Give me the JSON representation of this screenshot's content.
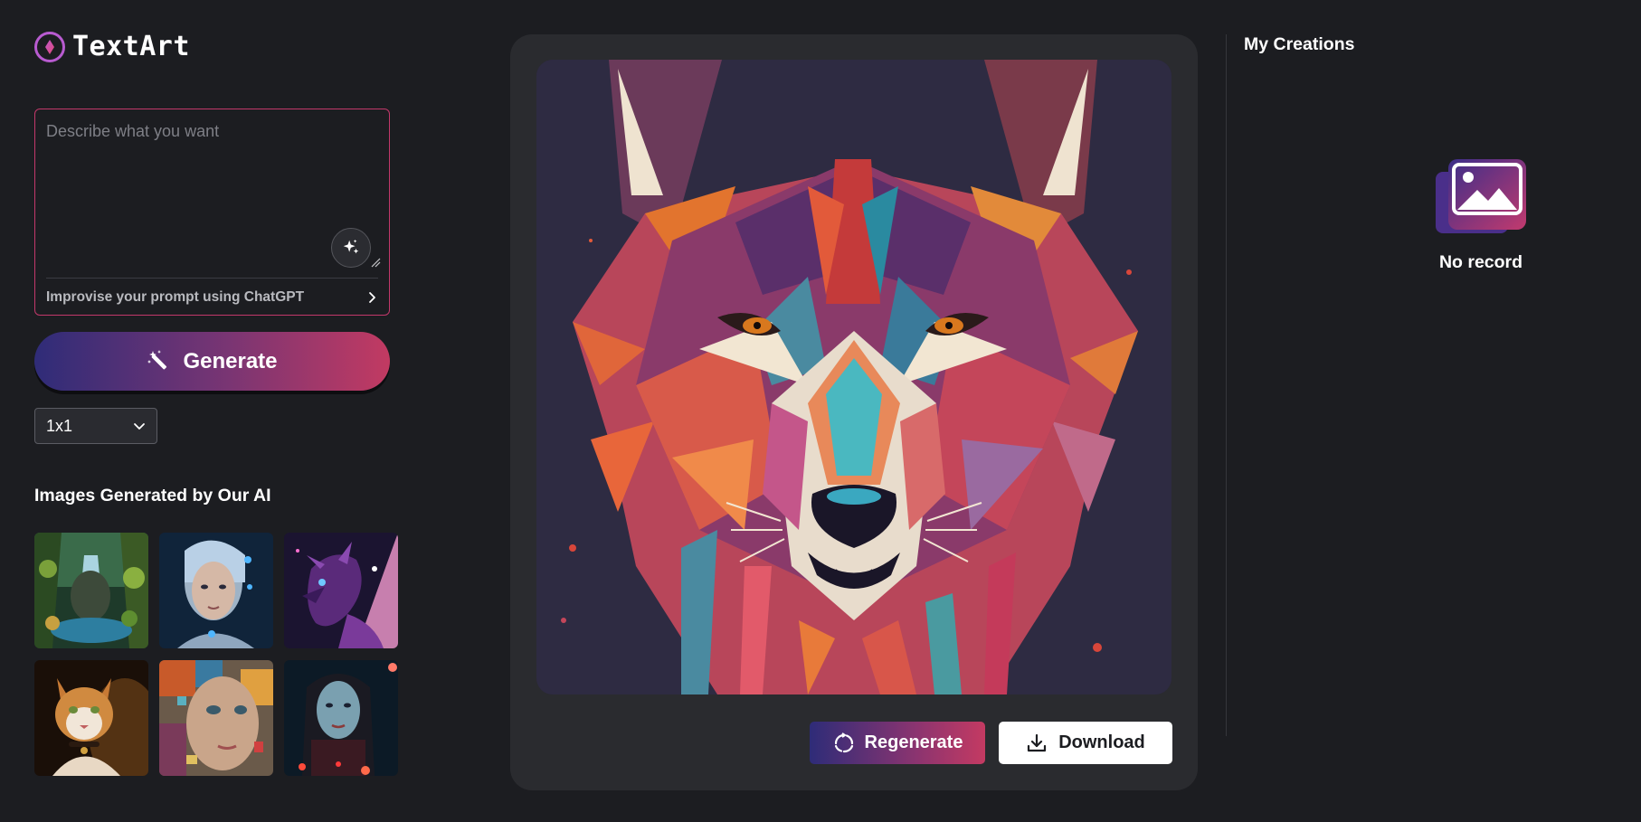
{
  "app": {
    "name": "TextArt"
  },
  "prompt": {
    "placeholder": "Describe what you want",
    "value": "",
    "improve_label": "Improvise your prompt using ChatGPT"
  },
  "generate": {
    "label": "Generate"
  },
  "aspect_ratio": {
    "selected": "1x1"
  },
  "gallery": {
    "title": "Images Generated by Our AI",
    "items": [
      {
        "subject": "fantasy forest waterfall"
      },
      {
        "subject": "cyborg girl portrait"
      },
      {
        "subject": "purple dragon"
      },
      {
        "subject": "cat with collar"
      },
      {
        "subject": "mosaic face"
      },
      {
        "subject": "girl portrait with lights"
      }
    ]
  },
  "result": {
    "subject": "geometric wolf portrait",
    "regenerate_label": "Regenerate",
    "download_label": "Download"
  },
  "creations": {
    "title": "My Creations",
    "empty_label": "No record"
  },
  "colors": {
    "background": "#1c1d21",
    "panel": "#2a2b2f",
    "accent_start": "#2f2c78",
    "accent_end": "#c23a62",
    "prompt_border": "#c2386a"
  },
  "icons": {
    "logo": "logo-icon",
    "magic": "sparkle-icon",
    "generate": "magic-wand-icon",
    "dropdown": "chevron-down-icon",
    "improve": "chevron-right-icon",
    "regenerate": "refresh-icon",
    "download": "download-icon",
    "empty": "image-icon"
  }
}
